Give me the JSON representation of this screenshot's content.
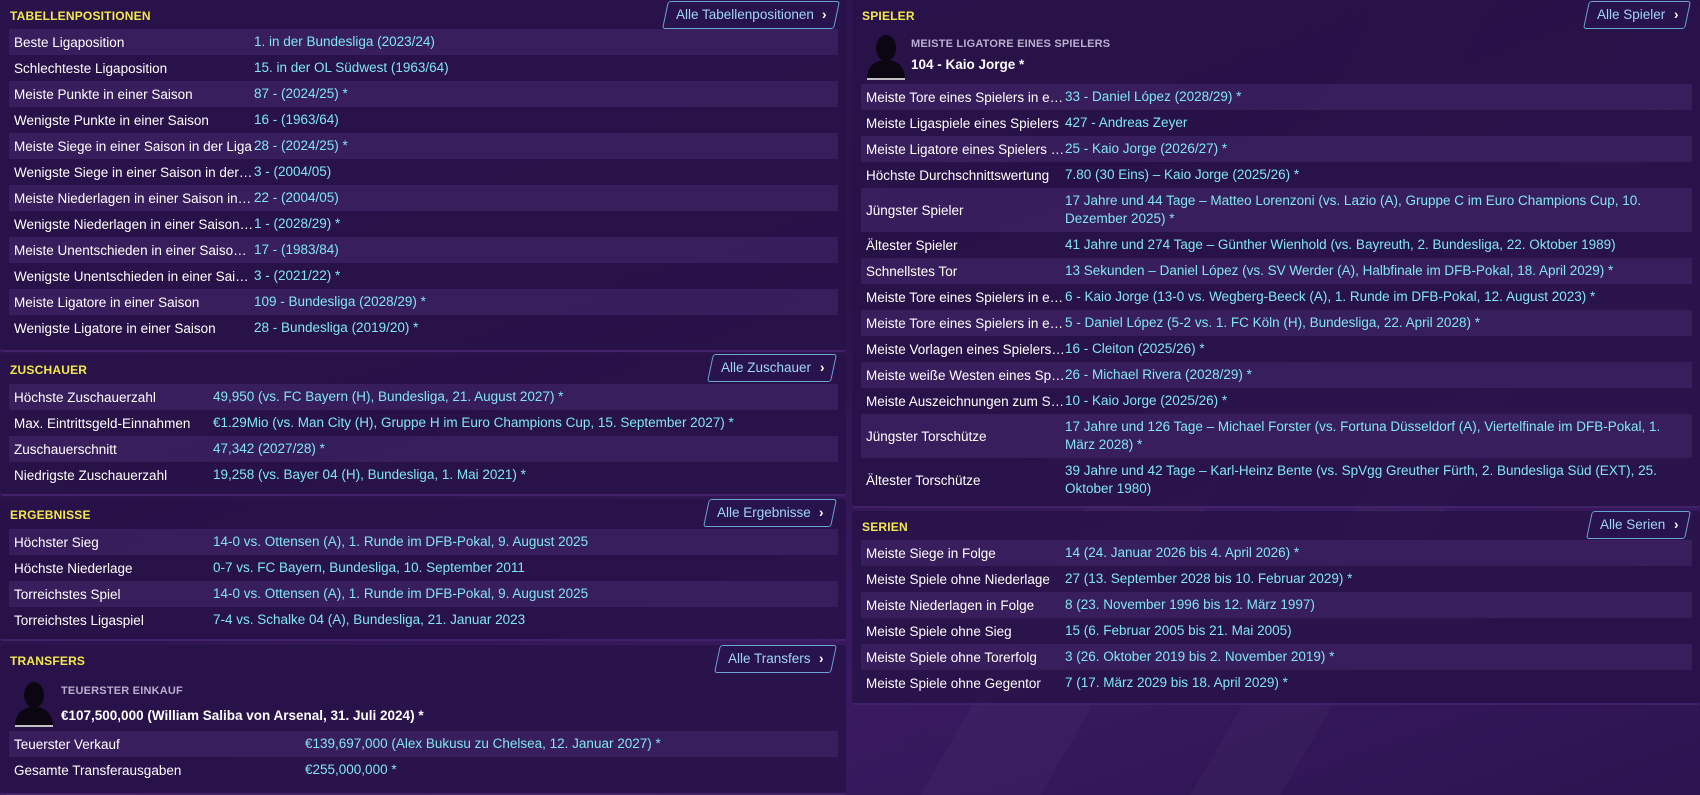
{
  "left": {
    "tabellenpositionen": {
      "title": "TABELLENPOSITIONEN",
      "all_button": "Alle Tabellenpositionen",
      "rows": [
        {
          "label": "Beste Ligaposition",
          "value": "1. in der Bundesliga (2023/24)"
        },
        {
          "label": "Schlechteste Ligaposition",
          "value": "15. in der OL Südwest (1963/64)"
        },
        {
          "label": "Meiste Punkte in einer Saison",
          "value": "87 - (2024/25) *"
        },
        {
          "label": "Wenigste Punkte in einer Saison",
          "value": "16 - (1963/64)"
        },
        {
          "label": "Meiste Siege in einer Saison in der Liga",
          "value": "28 - (2024/25) *"
        },
        {
          "label": "Wenigste Siege in einer Saison in der Li...",
          "value": "3 - (2004/05)"
        },
        {
          "label": "Meiste Niederlagen in einer Saison in d...",
          "value": "22 - (2004/05)"
        },
        {
          "label": "Wenigste Niederlagen in einer Saison i...",
          "value": "1 - (2028/29) *"
        },
        {
          "label": "Meiste Unentschieden in einer Saison i...",
          "value": "17 - (1983/84)"
        },
        {
          "label": "Wenigste Unentschieden in einer Saiso...",
          "value": "3 - (2021/22) *"
        },
        {
          "label": "Meiste Ligatore in einer Saison",
          "value": "109 - Bundesliga (2028/29) *"
        },
        {
          "label": "Wenigste Ligatore in einer Saison",
          "value": "28 - Bundesliga (2019/20) *"
        }
      ]
    },
    "zuschauer": {
      "title": "ZUSCHAUER",
      "all_button": "Alle Zuschauer",
      "rows": [
        {
          "label": "Höchste Zuschauerzahl",
          "value": "49,950 (vs. FC Bayern (H), Bundesliga, 21. August 2027) *"
        },
        {
          "label": "Max. Eintrittsgeld-Einnahmen",
          "value": "€1.29Mio (vs. Man City (H), Gruppe H im Euro Champions Cup, 15. September 2027) *"
        },
        {
          "label": "Zuschauerschnitt",
          "value": "47,342 (2027/28) *"
        },
        {
          "label": "Niedrigste Zuschauerzahl",
          "value": "19,258 (vs. Bayer 04 (H), Bundesliga, 1. Mai 2021) *"
        }
      ]
    },
    "ergebnisse": {
      "title": "ERGEBNISSE",
      "all_button": "Alle Ergebnisse",
      "rows": [
        {
          "label": "Höchster Sieg",
          "value": "14-0 vs. Ottensen (A), 1. Runde im DFB-Pokal, 9. August 2025"
        },
        {
          "label": "Höchste Niederlage",
          "value": "0-7 vs. FC Bayern, Bundesliga, 10. September 2011"
        },
        {
          "label": "Torreichstes Spiel",
          "value": "14-0 vs. Ottensen (A), 1. Runde im DFB-Pokal, 9. August 2025"
        },
        {
          "label": "Torreichstes Ligaspiel",
          "value": "7-4 vs. Schalke 04 (A), Bundesliga, 21. Januar 2023"
        }
      ]
    },
    "transfers": {
      "title": "TRANSFERS",
      "all_button": "Alle Transfers",
      "featured_sub": "TEUERSTER EINKAUF",
      "featured_main": "€107,500,000 (William Saliba von Arsenal, 31. Juli 2024) *",
      "rows": [
        {
          "label": "Teuerster Verkauf",
          "value": "€139,697,000 (Alex Bukusu zu Chelsea, 12. Januar 2027) *"
        },
        {
          "label": "Gesamte Transferausgaben",
          "value": "€255,000,000 *"
        }
      ]
    }
  },
  "right": {
    "spieler": {
      "title": "SPIELER",
      "all_button": "Alle Spieler",
      "featured_sub": "MEISTE LIGATORE EINES SPIELERS",
      "featured_main": "104 - Kaio Jorge *",
      "rows": [
        {
          "label": "Meiste Tore eines Spielers in ein...",
          "value": "33 - Daniel López (2028/29) *"
        },
        {
          "label": "Meiste Ligaspiele eines Spielers",
          "value": "427 - Andreas Zeyer"
        },
        {
          "label": "Meiste Ligatore eines Spielers in...",
          "value": "25 - Kaio Jorge (2026/27) *"
        },
        {
          "label": "Höchste Durchschnittswertung",
          "value": "7.80 (30 Eins) – Kaio Jorge (2025/26) *"
        },
        {
          "label": "Jüngster Spieler",
          "value": "17 Jahre und 44 Tage – Matteo Lorenzoni (vs. Lazio (A), Gruppe C im Euro Champions Cup, 10. Dezember 2025) *",
          "tall": true
        },
        {
          "label": "Ältester Spieler",
          "value": "41 Jahre und 274 Tage – Günther Wienhold (vs. Bayreuth, 2. Bundesliga, 22. Oktober 1989)"
        },
        {
          "label": "Schnellstes Tor",
          "value": "13 Sekunden – Daniel López (vs. SV Werder (A), Halbfinale im DFB-Pokal, 18. April 2029) *"
        },
        {
          "label": "Meiste Tore eines Spielers in ein...",
          "value": "6 - Kaio Jorge (13-0 vs. Wegberg-Beeck (A), 1. Runde im DFB-Pokal, 12. August 2023) *"
        },
        {
          "label": "Meiste Tore eines Spielers in ein...",
          "value": "5 - Daniel López (5-2 vs. 1. FC Köln (H), Bundesliga, 22. April 2028) *"
        },
        {
          "label": "Meiste Vorlagen eines Spielers i...",
          "value": "16 - Cleiton (2025/26) *"
        },
        {
          "label": "Meiste weiße Westen eines Spie...",
          "value": "26 - Michael Rivera (2028/29) *"
        },
        {
          "label": "Meiste Auszeichnungen zum Spi...",
          "value": "10 - Kaio Jorge (2025/26) *"
        },
        {
          "label": "Jüngster Torschütze",
          "value": "17 Jahre und 126 Tage – Michael Forster (vs. Fortuna Düsseldorf (A), Viertelfinale im DFB-Pokal, 1. März 2028) *",
          "tall": true
        },
        {
          "label": "Ältester Torschütze",
          "value": "39 Jahre und 42 Tage – Karl-Heinz Bente (vs. SpVgg Greuther Fürth, 2. Bundesliga Süd (EXT), 25. Oktober 1980)",
          "tall": true
        }
      ]
    },
    "serien": {
      "title": "SERIEN",
      "all_button": "Alle Serien",
      "rows": [
        {
          "label": "Meiste Siege in Folge",
          "value": "14 (24. Januar 2026 bis 4. April 2026) *"
        },
        {
          "label": "Meiste Spiele ohne Niederlage",
          "value": "27 (13. September 2028 bis 10. Februar 2029) *"
        },
        {
          "label": "Meiste Niederlagen in Folge",
          "value": "8 (23. November 1996 bis 12. März 1997)"
        },
        {
          "label": "Meiste Spiele ohne Sieg",
          "value": "15 (6. Februar 2005 bis 21. Mai 2005)"
        },
        {
          "label": "Meiste Spiele ohne Torerfolg",
          "value": "3 (26. Oktober 2019 bis 2. November 2019) *"
        },
        {
          "label": "Meiste Spiele ohne Gegentor",
          "value": "7 (17. März 2029 bis 18. April 2029) *"
        }
      ]
    }
  },
  "icons": {
    "chevron": "chevron-right-icon",
    "avatar": "player-silhouette-icon"
  },
  "colors": {
    "section_title": "#f4e84a",
    "value_text": "#7fe6f0",
    "button_text": "#9fd6f5",
    "background": "#2a1348"
  }
}
